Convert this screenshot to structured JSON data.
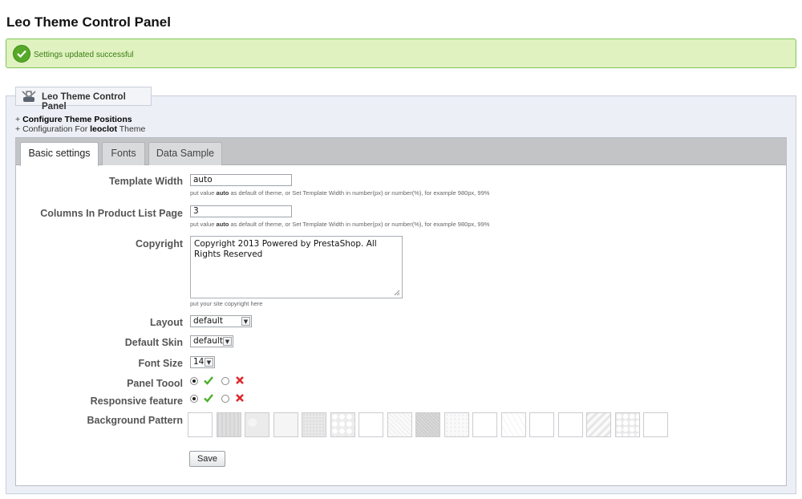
{
  "page": {
    "title": "Leo Theme Control Panel"
  },
  "alert": {
    "message": "Settings updated successful",
    "icon": "check-circle-icon",
    "color": "#56a829"
  },
  "panel": {
    "legend": "Leo Theme Control Panel",
    "link_configure_positions": "Configure Theme Positions",
    "config_prefix": "Configuration For",
    "config_theme": "leoclot",
    "config_suffix": "Theme",
    "plus": "+"
  },
  "tabs": [
    {
      "label": "Basic settings",
      "active": true
    },
    {
      "label": "Fonts",
      "active": false
    },
    {
      "label": "Data Sample",
      "active": false
    }
  ],
  "form": {
    "template_width": {
      "label": "Template Width",
      "value": "auto",
      "hint_a": "put value",
      "hint_b": "auto",
      "hint_c": "as default of theme, or Set Template Width in number(px) or number(%), for example 980px, 99%"
    },
    "columns": {
      "label": "Columns In Product List Page",
      "value": "3",
      "hint_a": "put value",
      "hint_b": "auto",
      "hint_c": "as default of theme, or Set Template Width in number(px) or number(%), for example 980px, 99%"
    },
    "copyright": {
      "label": "Copyright",
      "value": "Copyright 2013 Powered by PrestaShop. All Rights Reserved",
      "hint": "put your site copyright here"
    },
    "layout": {
      "label": "Layout",
      "value": "default"
    },
    "default_skin": {
      "label": "Default Skin",
      "value": "default"
    },
    "font_size": {
      "label": "Font Size",
      "value": "14"
    },
    "panel_tool": {
      "label": "Panel Toool",
      "selected": "yes"
    },
    "responsive": {
      "label": "Responsive feature",
      "selected": "yes"
    },
    "background_pattern": {
      "label": "Background Pattern",
      "count": 17
    },
    "save_label": "Save"
  },
  "colors": {
    "check": "#4caf2a",
    "cross": "#e0282d"
  }
}
